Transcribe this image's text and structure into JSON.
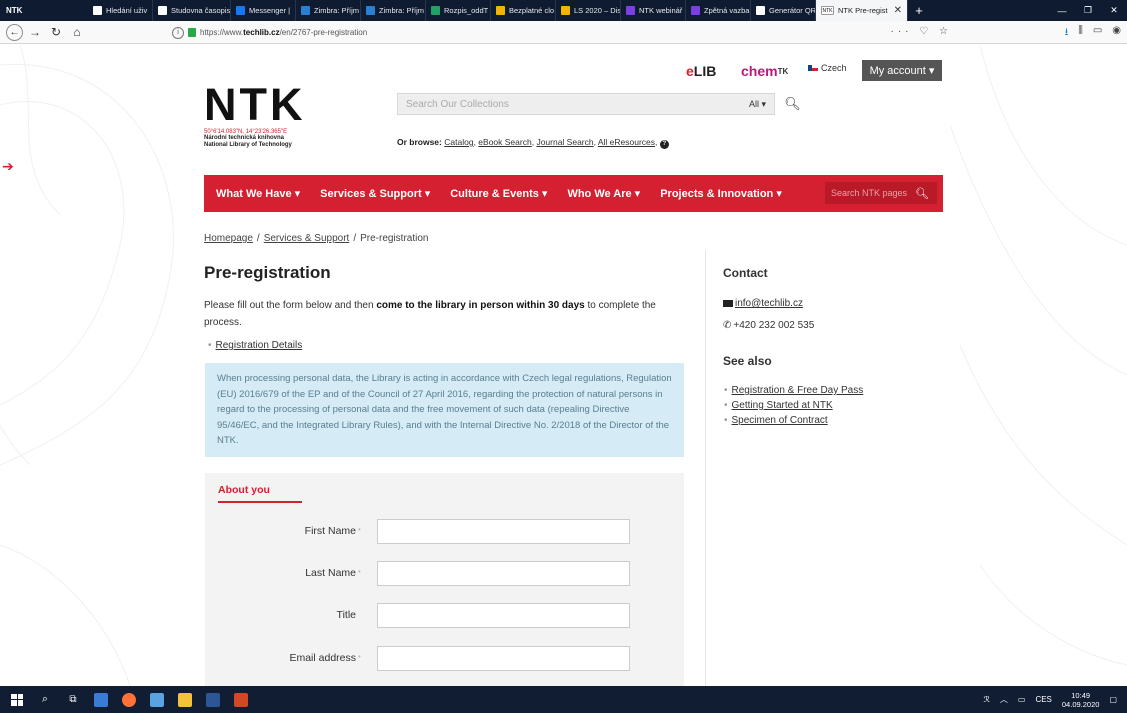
{
  "browser": {
    "app_label": "NTK",
    "tabs": [
      {
        "label": "Hledání uživ",
        "color": "#ffffff"
      },
      {
        "label": "Studovna časopis",
        "color": "#ffffff"
      },
      {
        "label": "Messenger |",
        "color": "#1877f2"
      },
      {
        "label": "Zimbra: Příjm",
        "color": "#2a7fd4"
      },
      {
        "label": "Zimbra: Příjm",
        "color": "#2a7fd4"
      },
      {
        "label": "Rozpis_oddT",
        "color": "#21a366"
      },
      {
        "label": "Bezplatné clo",
        "color": "#f4b400"
      },
      {
        "label": "LS 2020 – Disk",
        "color": "#f4b400"
      },
      {
        "label": "NTK webinář",
        "color": "#7b3fe4"
      },
      {
        "label": "Zpětná vazba",
        "color": "#7b3fe4"
      },
      {
        "label": "Generátor QR",
        "color": "#ffffff"
      }
    ],
    "active_tab": {
      "label": "NTK Pre-regist",
      "favicon": "NTK"
    },
    "url_prefix": "https://www.",
    "url_host": "techlib.cz",
    "url_path": "/en/2767-pre-registration",
    "url_actions": "··· ♡ ☆"
  },
  "utility": {
    "elib_e": "e",
    "elib_rest": "LIB",
    "chem": "chem",
    "chem_sup": "TK",
    "language": "Czech",
    "account": "My account ▾"
  },
  "logo": {
    "mark": "NTK",
    "coords": "50°6'14.083\"N, 14°23'26.365\"E",
    "name_cz": "Národní technická knihovna",
    "name_en": "National Library of Technology"
  },
  "search": {
    "placeholder": "Search Our Collections",
    "scope": "All ▾",
    "browse_label": "Or browse:",
    "browse_links": [
      "Catalog",
      "eBook Search",
      "Journal Search",
      "All eResources"
    ]
  },
  "menu": {
    "items": [
      "What We Have ▾",
      "Services & Support ▾",
      "Culture & Events ▾",
      "Who We Are ▾",
      "Projects & Innovation ▾"
    ],
    "search_placeholder": "Search NTK pages"
  },
  "breadcrumb": {
    "home": "Homepage",
    "section": "Services & Support",
    "current": "Pre-registration"
  },
  "content": {
    "title": "Pre-registration",
    "intro_a": "Please fill out the form below and then ",
    "intro_b": "come to the library in person within 30 days",
    "intro_c": " to complete the process.",
    "reg_link": "Registration Details",
    "notice": "When processing personal data, the Library is acting in accordance with Czech legal regulations, Regulation (EU) 2016/679 of the EP and of the Council of 27 April 2016, regarding the protection of natural persons in regard to the processing of personal data and the free movement of such data (repealing Directive 95/46/EC, and the Integrated Library Rules), and with the Internal Directive No. 2/2018 of the Director of the NTK."
  },
  "sidebar": {
    "contact_heading": "Contact",
    "email": "info@techlib.cz",
    "phone": "+420 232 002 535",
    "see_also_heading": "See also",
    "links": [
      "Registration & Free Day Pass",
      "Getting Started at NTK",
      "Specimen of Contract"
    ]
  },
  "form": {
    "heading": "About you",
    "fields": [
      {
        "label": "First Name",
        "required": "•"
      },
      {
        "label": "Last Name",
        "required": "•"
      },
      {
        "label": "Title",
        "required": ""
      },
      {
        "label": "Email address",
        "required": "•"
      }
    ]
  },
  "taskbar": {
    "language": "CES",
    "time": "10:49",
    "date": "04.09.2020"
  }
}
